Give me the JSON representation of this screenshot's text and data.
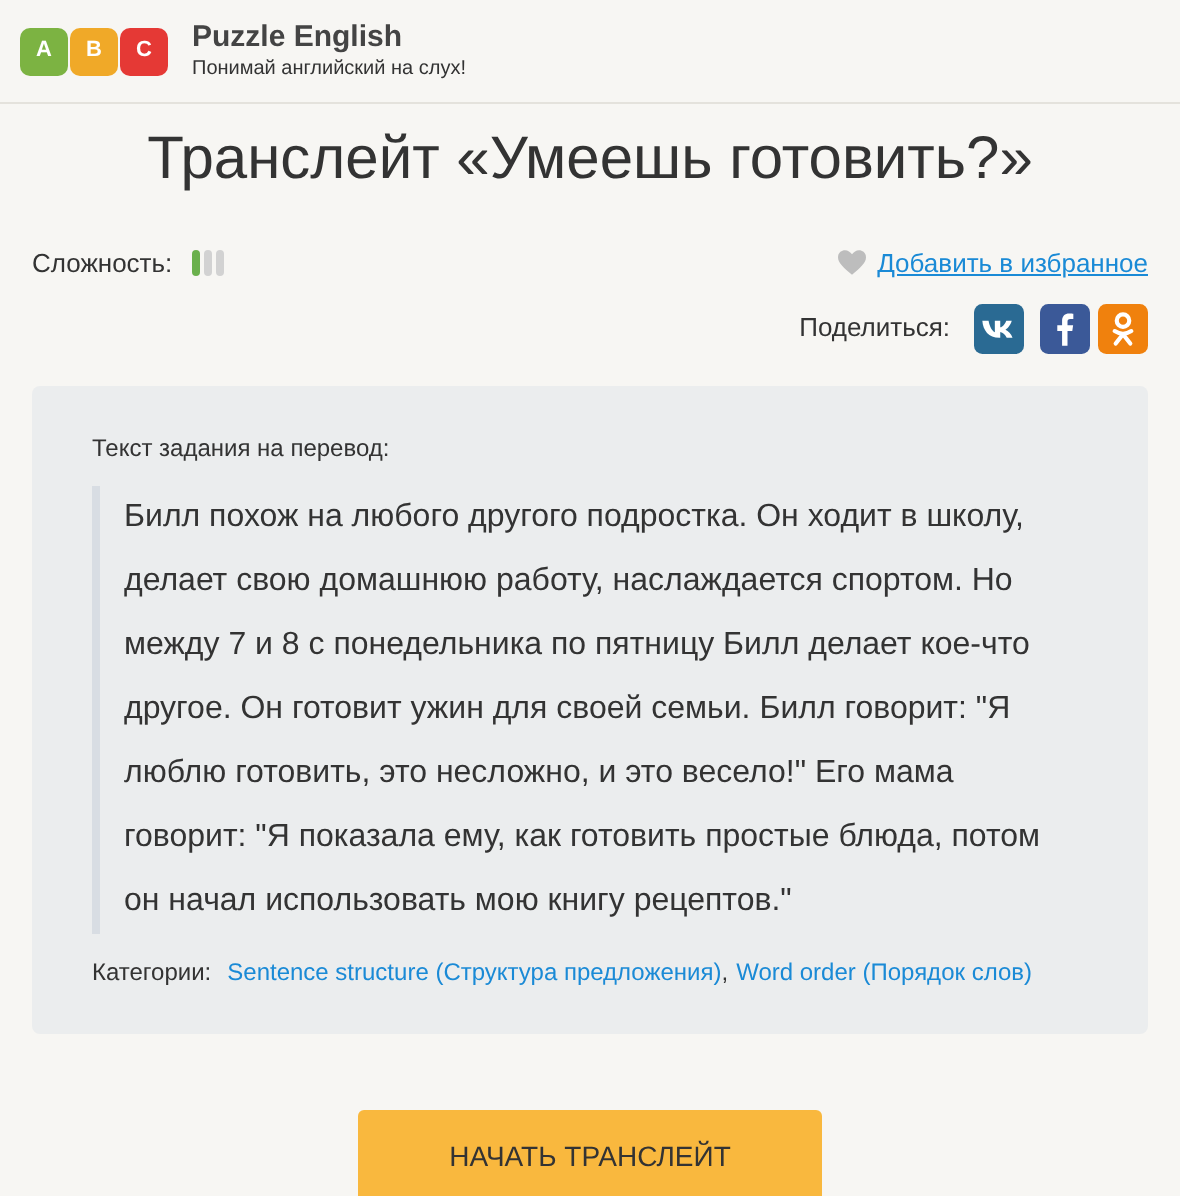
{
  "header": {
    "logo_letters": [
      {
        "letter": "A",
        "color": "#7cb342"
      },
      {
        "letter": "B",
        "color": "#f0a928"
      },
      {
        "letter": "C",
        "color": "#e53935"
      }
    ],
    "brand": "Puzzle English",
    "tagline": "Понимай английский на слух!"
  },
  "title": "Транслейт «Умеешь готовить?»",
  "difficulty": {
    "label": "Сложность:",
    "level": 0.33
  },
  "favorite": {
    "label": "Добавить в избранное"
  },
  "share": {
    "label": "Поделиться:",
    "buttons": [
      {
        "kind": "vk",
        "color": "#2a6a93"
      },
      {
        "kind": "facebook",
        "color": "#3b5998"
      },
      {
        "kind": "odnoklassniki",
        "color": "#f0810d"
      }
    ]
  },
  "task": {
    "label": "Текст задания на перевод:",
    "text": "Билл похож на любого другого подростка. Он ходит в школу, делает свою домашнюю работу, наслаждается спортом. Но между 7 и 8 с понедельника по пятницу Билл делает кое-что другое. Он готовит ужин для своей семьи. Билл говорит: \"Я люблю готовить, это несложно, и это весело!\" Его мама говорит: \"Я показала ему, как готовить простые блюда, потом он начал использовать мою книгу рецептов.\"",
    "categories_label": "Категории:",
    "categories": [
      {
        "label": "Sentence structure (Структура предложения)",
        "separator": ","
      },
      {
        "label": "Word order (Порядок слов)"
      }
    ]
  },
  "start_button": "НАЧАТЬ ТРАНСЛЕЙТ"
}
